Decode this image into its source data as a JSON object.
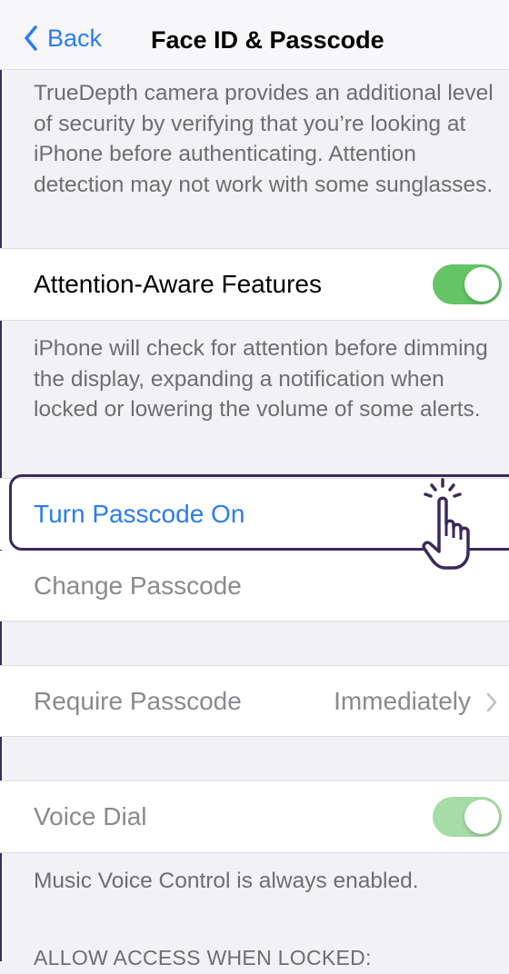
{
  "nav": {
    "back_label": "Back",
    "title": "Face ID & Passcode"
  },
  "intro_text": "TrueDepth camera provides an additional level of security by verifying that you’re looking at iPhone before authenticating. Attention detection may not work with some sunglasses.",
  "attention": {
    "label": "Attention-Aware Features",
    "enabled": true,
    "footer": "iPhone will check for attention before dimming the display, expanding a notification when locked or lowering the volume of some alerts."
  },
  "passcode": {
    "turn_on_label": "Turn Passcode On",
    "change_label": "Change Passcode"
  },
  "require_passcode": {
    "label": "Require Passcode",
    "value": "Immediately"
  },
  "voice_dial": {
    "label": "Voice Dial",
    "enabled": true,
    "footer": "Music Voice Control is always enabled."
  },
  "allow_access_header": "ALLOW ACCESS WHEN LOCKED:",
  "colors": {
    "accent_blue": "#2a7cf6",
    "toggle_green": "#65c466",
    "highlight_outline": "#3a2a5c"
  },
  "icons": {
    "back": "chevron-left-icon",
    "disclosure": "chevron-right-icon",
    "pointer": "hand-pointer-icon"
  }
}
